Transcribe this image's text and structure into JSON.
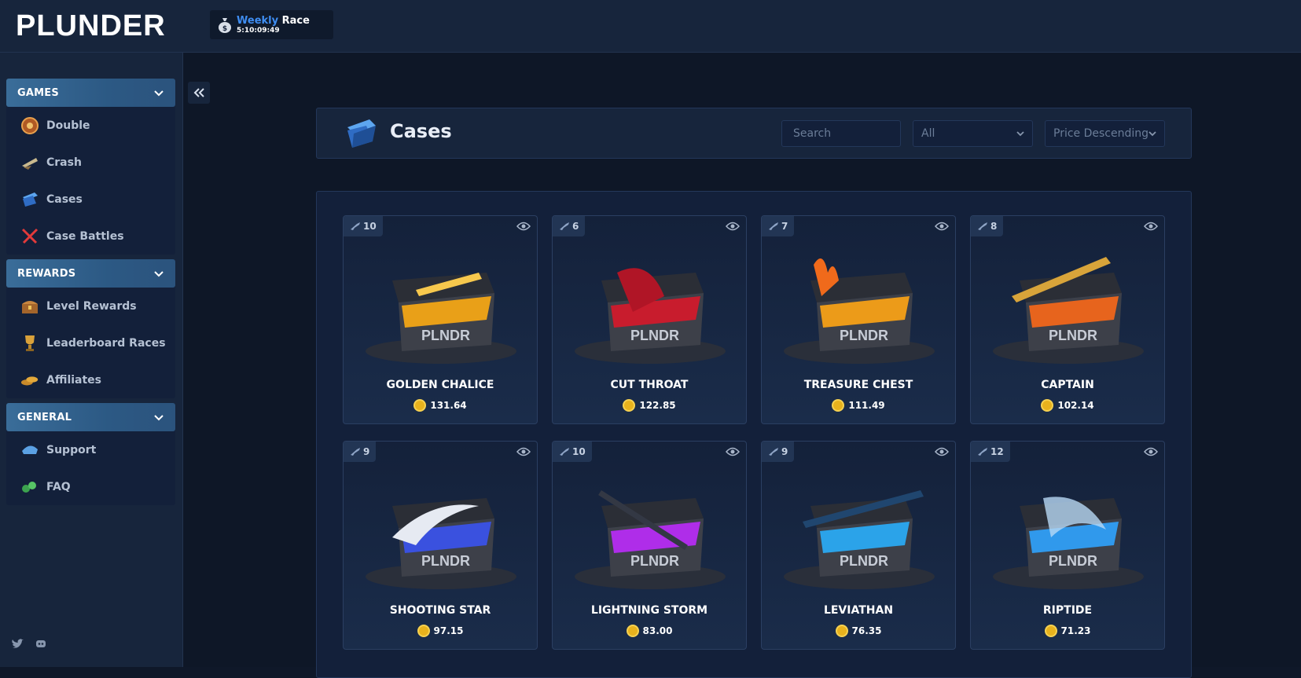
{
  "app": {
    "logo_text": "PLUNDER"
  },
  "race": {
    "highlight": "Weekly",
    "name": "Race",
    "timer": "5:10:09:49"
  },
  "sidebar": {
    "groups": [
      {
        "title": "GAMES",
        "items": [
          {
            "label": "Double",
            "icon": "roulette-icon"
          },
          {
            "label": "Crash",
            "icon": "crash-ship-icon"
          },
          {
            "label": "Cases",
            "icon": "case-icon"
          },
          {
            "label": "Case Battles",
            "icon": "swords-icon"
          }
        ]
      },
      {
        "title": "REWARDS",
        "items": [
          {
            "label": "Level Rewards",
            "icon": "treasure-chest-icon"
          },
          {
            "label": "Leaderboard Races",
            "icon": "trophy-icon"
          },
          {
            "label": "Affiliates",
            "icon": "coins-icon"
          }
        ]
      },
      {
        "title": "GENERAL",
        "items": [
          {
            "label": "Support",
            "icon": "support-icon"
          },
          {
            "label": "FAQ",
            "icon": "faq-icon"
          }
        ]
      }
    ],
    "social": [
      "twitter-icon",
      "discord-icon"
    ]
  },
  "cases_header": {
    "title": "Cases",
    "search_placeholder": "Search",
    "filter_value": "All",
    "sort_value": "Price Descending"
  },
  "cases": [
    {
      "name": "GOLDEN CHALICE",
      "price": "131.64",
      "items": "10",
      "color": "#f2a516"
    },
    {
      "name": "CUT THROAT",
      "price": "122.85",
      "items": "6",
      "color": "#d01a2c"
    },
    {
      "name": "TREASURE CHEST",
      "price": "111.49",
      "items": "7",
      "color": "#f5a017"
    },
    {
      "name": "CAPTAIN",
      "price": "102.14",
      "items": "8",
      "color": "#f0661b"
    },
    {
      "name": "SHOOTING STAR",
      "price": "97.15",
      "items": "9",
      "color": "#3a52e8"
    },
    {
      "name": "LIGHTNING STORM",
      "price": "83.00",
      "items": "10",
      "color": "#b52cf2"
    },
    {
      "name": "LEVIATHAN",
      "price": "76.35",
      "items": "9",
      "color": "#2aa9f2"
    },
    {
      "name": "RIPTIDE",
      "price": "71.23",
      "items": "12",
      "color": "#2f9ef6"
    }
  ],
  "colors": {
    "accent": "#3f8ef3",
    "coin": "#e8b21d",
    "panel": "#17253c",
    "bg": "#0e1727"
  }
}
